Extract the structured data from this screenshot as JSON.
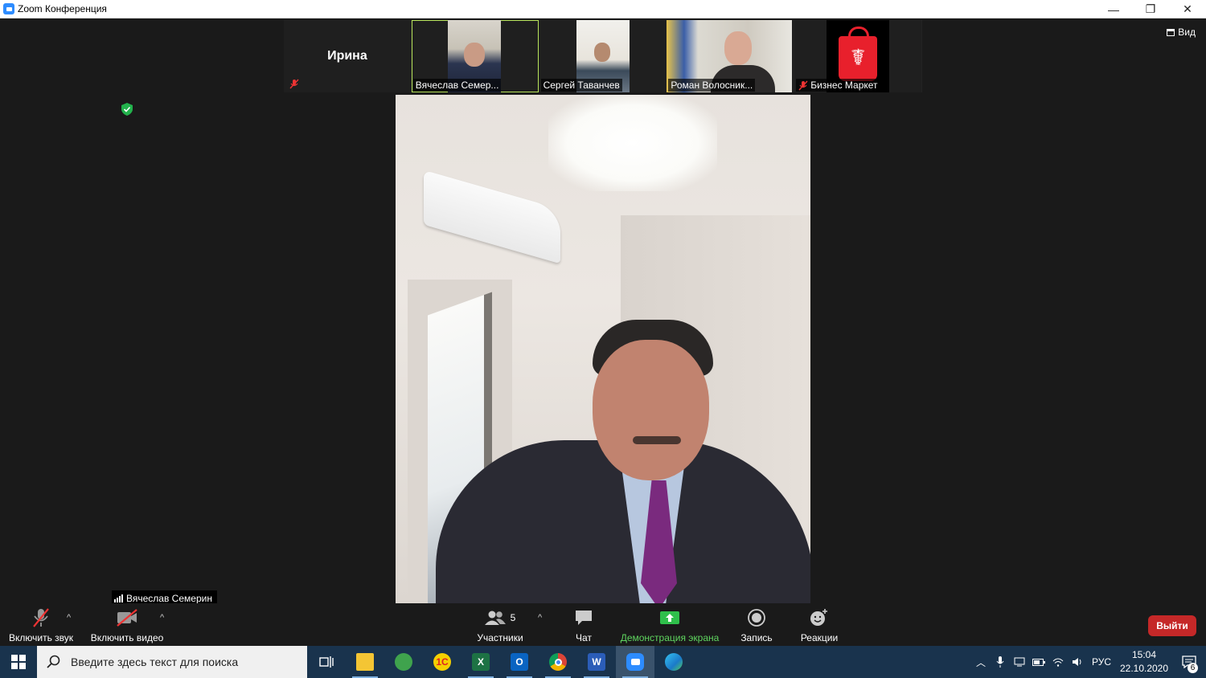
{
  "window": {
    "title": "Zoom Конференция",
    "minimize": "—",
    "restore": "❐",
    "close": "✕"
  },
  "view_button": {
    "label": "Вид",
    "icon": "grid-icon"
  },
  "participants_strip": [
    {
      "name": "Ирина",
      "video": false,
      "muted": true
    },
    {
      "name": "Вячеслав Семер...",
      "video": true,
      "muted": false,
      "active_speaker": true
    },
    {
      "name": "Сергей Таванчев",
      "video": true,
      "muted": false
    },
    {
      "name": "Роман Волосник...",
      "video": true,
      "muted": false
    },
    {
      "name": "Бизнес Маркет",
      "video": true,
      "muted": true
    }
  ],
  "speaker": {
    "name": "Вячеслав Семерин"
  },
  "controls": {
    "unmute_label": "Включить звук",
    "start_video_label": "Включить видео",
    "participants_label": "Участники",
    "participants_count": "5",
    "chat_label": "Чат",
    "share_label": "Демонстрация экрана",
    "record_label": "Запись",
    "reactions_label": "Реакции",
    "leave_label": "Выйти",
    "caret": "^"
  },
  "taskbar": {
    "search_placeholder": "Введите здесь текст для поиска",
    "language": "РУС",
    "time": "15:04",
    "date": "22.10.2020",
    "notifications": "6",
    "apps": [
      "task-view",
      "file-explorer",
      "maps",
      "1c",
      "excel",
      "outlook",
      "chrome",
      "word",
      "zoom",
      "edge"
    ]
  },
  "colors": {
    "accent_green": "#5fd45f",
    "leave_red": "#c52828",
    "taskbar": "#19334d",
    "zoom_blue": "#2d8cff"
  }
}
